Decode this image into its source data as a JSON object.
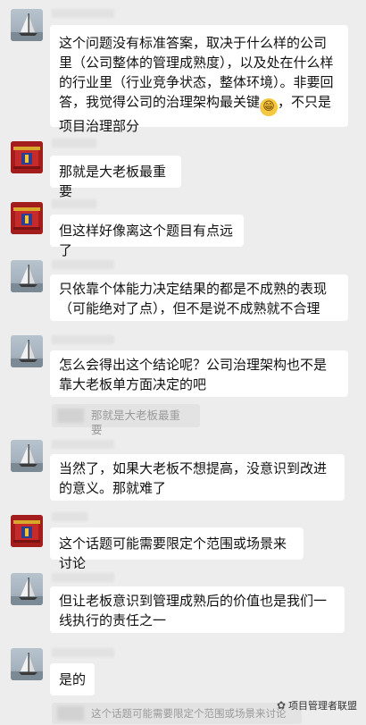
{
  "messages": [
    {
      "avatar": "sailboat-avatar",
      "text": "这个问题没有标准答案，取决于什么样的公司里（公司整体的管理成熟度），以及处在什么样的行业里（行业竞争状态，整体环境）。非要回答，我觉得公司的治理架构最关键",
      "emoji": "grin-emoji",
      "text_after": "，不只是项目治理部分"
    },
    {
      "avatar": "red-building-avatar",
      "text": "那就是大老板最重要"
    },
    {
      "avatar": "red-building-avatar",
      "text": "但这样好像离这个题目有点远了"
    },
    {
      "avatar": "sailboat-avatar",
      "text": "只依靠个体能力决定结果的都是不成熟的表现（可能绝对了点），但不是说不成熟就不合理"
    },
    {
      "avatar": "sailboat-avatar",
      "text": "怎么会得出这个结论呢？公司治理架构也不是靠大老板单方面决定的吧",
      "quote": "那就是大老板最重要"
    },
    {
      "avatar": "sailboat-avatar",
      "text": "当然了，如果大老板不想提高，没意识到改进的意义。那就难了"
    },
    {
      "avatar": "red-building-avatar",
      "text": "这个话题可能需要限定个范围或场景来讨论"
    },
    {
      "avatar": "sailboat-avatar",
      "text": "但让老板意识到管理成熟后的价值也是我们一线执行的责任之一"
    },
    {
      "avatar": "sailboat-avatar",
      "text": "是的",
      "quote": "这个话题可能需要限定个范围或场景来讨论"
    }
  ],
  "watermark": "项目管理者联盟",
  "colors": {
    "background": "#ededed",
    "bubble": "#ffffff",
    "quote_bg": "#e3e3e3",
    "red_avatar": "#a41d1d"
  }
}
